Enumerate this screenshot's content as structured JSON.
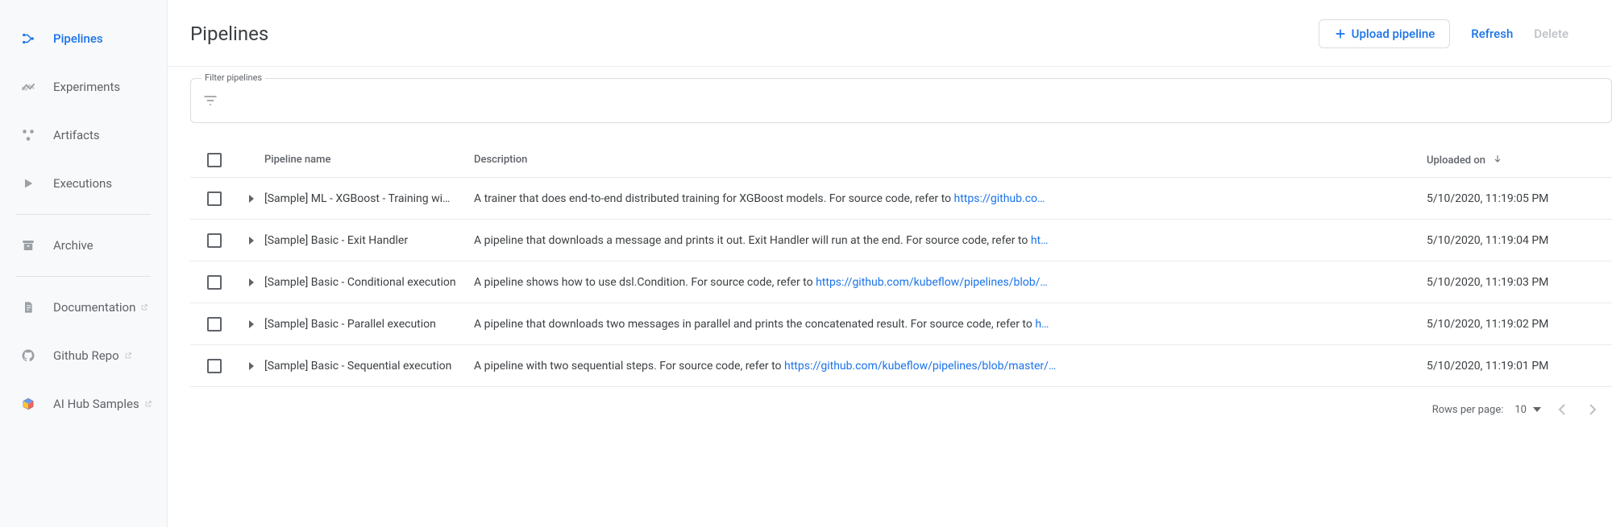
{
  "sidebar": {
    "items": [
      {
        "label": "Pipelines"
      },
      {
        "label": "Experiments"
      },
      {
        "label": "Artifacts"
      },
      {
        "label": "Executions"
      },
      {
        "label": "Archive"
      },
      {
        "label": "Documentation"
      },
      {
        "label": "Github Repo"
      },
      {
        "label": "AI Hub Samples"
      }
    ]
  },
  "header": {
    "title": "Pipelines",
    "upload": "Upload pipeline",
    "refresh": "Refresh",
    "delete": "Delete"
  },
  "filter": {
    "label": "Filter pipelines"
  },
  "table": {
    "columns": {
      "name": "Pipeline name",
      "desc": "Description",
      "uploaded": "Uploaded on"
    },
    "rows": [
      {
        "name": "[Sample] ML - XGBoost - Training wi…",
        "desc_pre": "A trainer that does end-to-end distributed training for XGBoost models. For source code, refer to ",
        "desc_link": "https://github.co…",
        "uploaded": "5/10/2020, 11:19:05 PM"
      },
      {
        "name": "[Sample] Basic - Exit Handler",
        "desc_pre": "A pipeline that downloads a message and prints it out. Exit Handler will run at the end. For source code, refer to ",
        "desc_link": "ht…",
        "uploaded": "5/10/2020, 11:19:04 PM"
      },
      {
        "name": "[Sample] Basic - Conditional execution",
        "desc_pre": "A pipeline shows how to use dsl.Condition. For source code, refer to ",
        "desc_link": "https://github.com/kubeflow/pipelines/blob/…",
        "uploaded": "5/10/2020, 11:19:03 PM"
      },
      {
        "name": "[Sample] Basic - Parallel execution",
        "desc_pre": "A pipeline that downloads two messages in parallel and prints the concatenated result. For source code, refer to ",
        "desc_link": "h…",
        "uploaded": "5/10/2020, 11:19:02 PM"
      },
      {
        "name": "[Sample] Basic - Sequential execution",
        "desc_pre": "A pipeline with two sequential steps. For source code, refer to ",
        "desc_link": "https://github.com/kubeflow/pipelines/blob/master/…",
        "uploaded": "5/10/2020, 11:19:01 PM"
      }
    ]
  },
  "pager": {
    "label": "Rows per page:",
    "value": "10"
  }
}
